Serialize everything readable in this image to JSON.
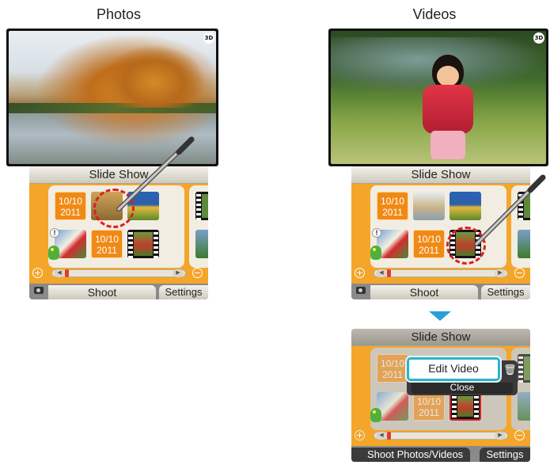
{
  "headings": {
    "left": "Photos",
    "right": "Videos"
  },
  "panel": {
    "slideshow_label": "Slide Show",
    "shoot_label": "Shoot",
    "settings_label": "Settings",
    "date_line1": "10/10",
    "date_line2": "2011",
    "badge_3d": "3D"
  },
  "popup_panel": {
    "slideshow_label": "Slide Show",
    "edit_label": "Edit Video",
    "close_label": "Close",
    "shoot_label": "Shoot Photos/Videos",
    "settings_label": "Settings"
  },
  "colors": {
    "accent": "#2ab4c9",
    "panel_orange": "#f4a62a",
    "arrow_blue": "#2a9ed8",
    "selection_red": "#e01e1e"
  },
  "icons": [
    "camera-icon",
    "trash-icon",
    "zoom-in-icon",
    "zoom-out-icon",
    "stylus-icon",
    "alert-icon",
    "3d-badge-icon"
  ]
}
